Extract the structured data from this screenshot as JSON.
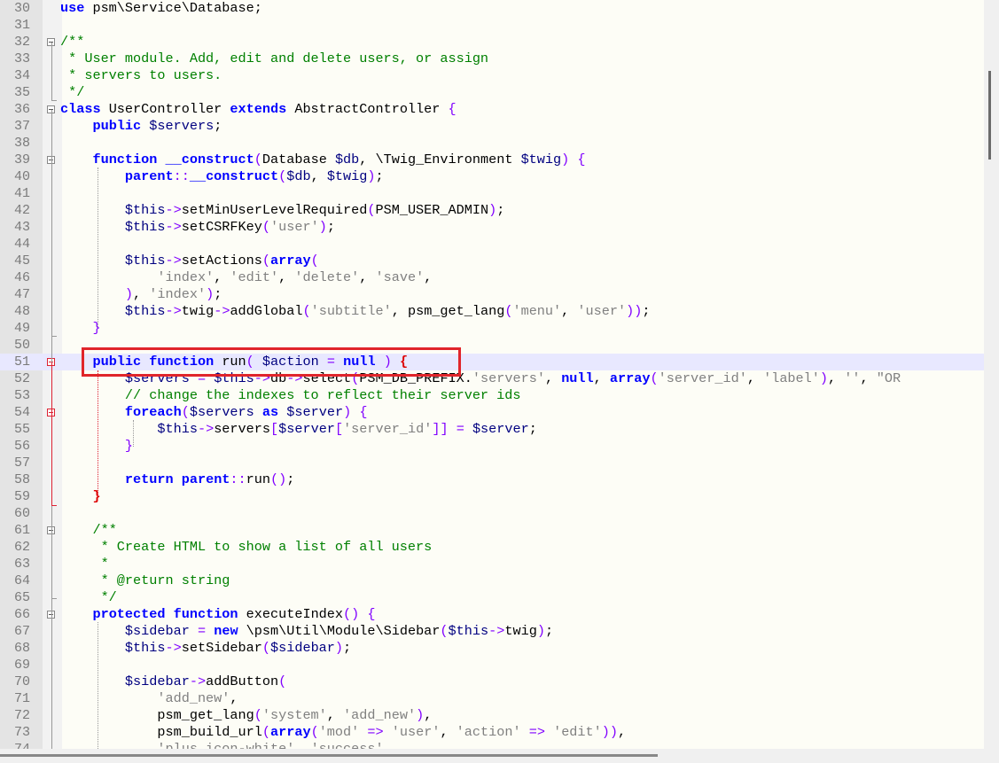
{
  "editor": {
    "lines": [
      {
        "n": "30",
        "html": "<span class=\"kw\">use</span> psm\\Service\\Database;"
      },
      {
        "n": "31",
        "html": ""
      },
      {
        "n": "32",
        "html": "<span class=\"cm\">/**</span>"
      },
      {
        "n": "33",
        "html": "<span class=\"cm\"> * User module. Add, edit and delete users, or assign</span>"
      },
      {
        "n": "34",
        "html": "<span class=\"cm\"> * servers to users.</span>"
      },
      {
        "n": "35",
        "html": "<span class=\"cm\"> */</span>"
      },
      {
        "n": "36",
        "html": "<span class=\"kw\">class</span> UserController <span class=\"kw\">extends</span> AbstractController <span class=\"op\">{</span>"
      },
      {
        "n": "37",
        "html": "    <span class=\"kw\">public</span> <span class=\"var\">$servers</span>;"
      },
      {
        "n": "38",
        "html": ""
      },
      {
        "n": "39",
        "html": "    <span class=\"kw\">function</span> <span class=\"kw\">__construct</span><span class=\"op\">(</span>Database <span class=\"var\">$db</span>, \\Twig_Environment <span class=\"var\">$twig</span><span class=\"op\">)</span> <span class=\"op\">{</span>"
      },
      {
        "n": "40",
        "html": "        <span class=\"kw\">parent</span><span class=\"op\">::</span><span class=\"kw\">__construct</span><span class=\"op\">(</span><span class=\"var\">$db</span>, <span class=\"var\">$twig</span><span class=\"op\">)</span>;"
      },
      {
        "n": "41",
        "html": ""
      },
      {
        "n": "42",
        "html": "        <span class=\"var\">$this</span><span class=\"op\">-&gt;</span>setMinUserLevelRequired<span class=\"op\">(</span>PSM_USER_ADMIN<span class=\"op\">)</span>;"
      },
      {
        "n": "43",
        "html": "        <span class=\"var\">$this</span><span class=\"op\">-&gt;</span>setCSRFKey<span class=\"op\">(</span><span class=\"str\">'user'</span><span class=\"op\">)</span>;"
      },
      {
        "n": "44",
        "html": ""
      },
      {
        "n": "45",
        "html": "        <span class=\"var\">$this</span><span class=\"op\">-&gt;</span>setActions<span class=\"op\">(</span><span class=\"kw\">array</span><span class=\"op\">(</span>"
      },
      {
        "n": "46",
        "html": "            <span class=\"str\">'index'</span>, <span class=\"str\">'edit'</span>, <span class=\"str\">'delete'</span>, <span class=\"str\">'save'</span>,"
      },
      {
        "n": "47",
        "html": "        <span class=\"op\">)</span>, <span class=\"str\">'index'</span><span class=\"op\">)</span>;"
      },
      {
        "n": "48",
        "html": "        <span class=\"var\">$this</span><span class=\"op\">-&gt;</span>twig<span class=\"op\">-&gt;</span>addGlobal<span class=\"op\">(</span><span class=\"str\">'subtitle'</span>, psm_get_lang<span class=\"op\">(</span><span class=\"str\">'menu'</span>, <span class=\"str\">'user'</span><span class=\"op\">))</span>;"
      },
      {
        "n": "49",
        "html": "    <span class=\"op\">}</span>"
      },
      {
        "n": "50",
        "html": ""
      },
      {
        "n": "51",
        "html": "    <span class=\"kw\">public</span> <span class=\"kw\">function</span> run<span class=\"op\">(</span> <span class=\"var\">$action</span> <span class=\"op\">=</span> <span class=\"kw\">null</span> <span class=\"op\">)</span> <span style=\"color:#d00;font-weight:bold\">{</span>"
      },
      {
        "n": "52",
        "html": "        <span class=\"var\">$servers</span> <span class=\"op\">=</span> <span class=\"var\">$this</span><span class=\"op\">-&gt;</span>db<span class=\"op\">-&gt;</span>select<span class=\"op\">(</span>PSM_DB_PREFIX.<span class=\"str\">'servers'</span>, <span class=\"kw\">null</span>, <span class=\"kw\">array</span><span class=\"op\">(</span><span class=\"str\">'server_id'</span>, <span class=\"str\">'label'</span><span class=\"op\">)</span>, <span class=\"str\">''</span>, <span class=\"str\">\"OR</span>"
      },
      {
        "n": "53",
        "html": "        <span class=\"cm\">// change the indexes to reflect their server ids</span>"
      },
      {
        "n": "54",
        "html": "        <span class=\"kw\">foreach</span><span class=\"op\">(</span><span class=\"var\">$servers</span> <span class=\"kw\">as</span> <span class=\"var\">$server</span><span class=\"op\">)</span> <span class=\"op\">{</span>"
      },
      {
        "n": "55",
        "html": "            <span class=\"var\">$this</span><span class=\"op\">-&gt;</span>servers<span class=\"op\">[</span><span class=\"var\">$server</span><span class=\"op\">[</span><span class=\"str\">'server_id'</span><span class=\"op\">]]</span> <span class=\"op\">=</span> <span class=\"var\">$server</span>;"
      },
      {
        "n": "56",
        "html": "        <span class=\"op\">}</span>"
      },
      {
        "n": "57",
        "html": ""
      },
      {
        "n": "58",
        "html": "        <span class=\"kw\">return</span> <span class=\"kw\">parent</span><span class=\"op\">::</span>run<span class=\"op\">()</span>;"
      },
      {
        "n": "59",
        "html": "    <span style=\"color:#d00;font-weight:bold\">}</span>"
      },
      {
        "n": "60",
        "html": ""
      },
      {
        "n": "61",
        "html": "    <span class=\"cm\">/**</span>"
      },
      {
        "n": "62",
        "html": "<span class=\"cm\">     * Create HTML to show a list of all users</span>"
      },
      {
        "n": "63",
        "html": "<span class=\"cm\">     *</span>"
      },
      {
        "n": "64",
        "html": "<span class=\"cm\">     * @return string</span>"
      },
      {
        "n": "65",
        "html": "<span class=\"cm\">     */</span>"
      },
      {
        "n": "66",
        "html": "    <span class=\"kw\">protected</span> <span class=\"kw\">function</span> executeIndex<span class=\"op\">()</span> <span class=\"op\">{</span>"
      },
      {
        "n": "67",
        "html": "        <span class=\"var\">$sidebar</span> <span class=\"op\">=</span> <span class=\"kw\">new</span> \\psm\\Util\\Module\\Sidebar<span class=\"op\">(</span><span class=\"var\">$this</span><span class=\"op\">-&gt;</span>twig<span class=\"op\">)</span>;"
      },
      {
        "n": "68",
        "html": "        <span class=\"var\">$this</span><span class=\"op\">-&gt;</span>setSidebar<span class=\"op\">(</span><span class=\"var\">$sidebar</span><span class=\"op\">)</span>;"
      },
      {
        "n": "69",
        "html": ""
      },
      {
        "n": "70",
        "html": "        <span class=\"var\">$sidebar</span><span class=\"op\">-&gt;</span>addButton<span class=\"op\">(</span>"
      },
      {
        "n": "71",
        "html": "            <span class=\"str\">'add_new'</span>,"
      },
      {
        "n": "72",
        "html": "            psm_get_lang<span class=\"op\">(</span><span class=\"str\">'system'</span>, <span class=\"str\">'add_new'</span><span class=\"op\">)</span>,"
      },
      {
        "n": "73",
        "html": "            psm_build_url<span class=\"op\">(</span><span class=\"kw\">array</span><span class=\"op\">(</span><span class=\"str\">'mod'</span> <span class=\"op\">=&gt;</span> <span class=\"str\">'user'</span>, <span class=\"str\">'action'</span> <span class=\"op\">=&gt;</span> <span class=\"str\">'edit'</span><span class=\"op\">))</span>,"
      },
      {
        "n": "74",
        "html": "            <span class=\"str\">'plus icon-white'</span>, <span class=\"str\">'success'</span>"
      }
    ],
    "current_line": "51",
    "fold_markers": [
      "32",
      "36",
      "39",
      "51",
      "54",
      "61",
      "66"
    ],
    "highlighted_line": "51"
  }
}
